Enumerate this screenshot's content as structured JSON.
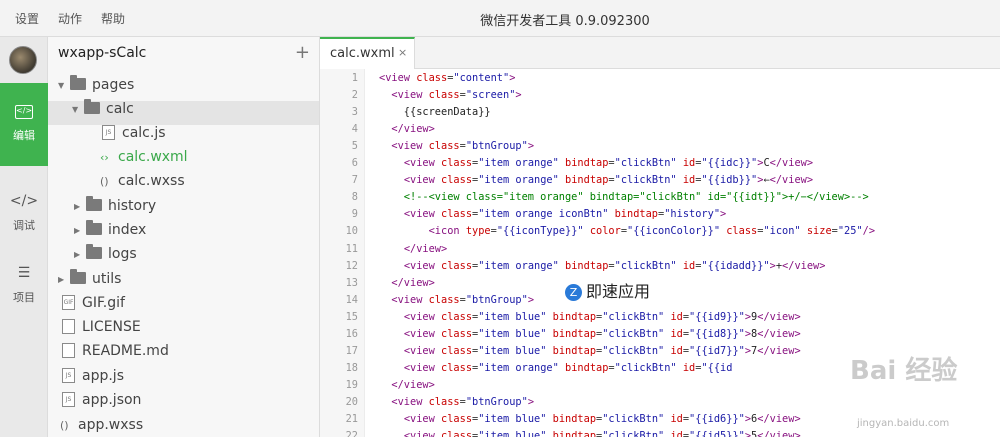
{
  "menu": {
    "items": [
      "设置",
      "动作",
      "帮助"
    ],
    "title": "微信开发者工具 0.9.092300"
  },
  "activity": {
    "edit_label": "编辑",
    "debug_label": "调试",
    "project_label": "项目"
  },
  "tree": {
    "project_name": "wxapp-sCalc",
    "add_label": "+",
    "nodes": [
      "pages",
      "calc",
      "calc.js",
      "calc.wxml",
      "calc.wxss",
      "history",
      "index",
      "logs",
      "utils",
      "GIF.gif",
      "LICENSE",
      "README.md",
      "app.js",
      "app.json",
      "app.wxss"
    ]
  },
  "tab": {
    "label": "calc.wxml",
    "close": "×"
  },
  "code": {
    "line_numbers": [
      "1",
      "2",
      "3",
      "4",
      "5",
      "6",
      "7",
      "8",
      "9",
      "10",
      "11",
      "12",
      "13",
      "14",
      "15",
      "16",
      "17",
      "18",
      "19",
      "20",
      "21",
      "22"
    ],
    "lines": [
      "<view class=\"content\">",
      "  <view class=\"screen\">",
      "    {{screenData}}",
      "  </view>",
      "  <view class=\"btnGroup\">",
      "    <view class=\"item orange\" bindtap=\"clickBtn\" id=\"{{idc}}\">C</view>",
      "    <view class=\"item orange\" bindtap=\"clickBtn\" id=\"{{idb}}\">←</view>",
      "    <!--<view class=\"item orange\" bindtap=\"clickBtn\" id=\"{{idt}}\">+/−</view>-->",
      "    <view class=\"item orange iconBtn\" bindtap=\"history\">",
      "        <icon type=\"{{iconType}}\" color=\"{{iconColor}}\" class=\"icon\" size=\"25\"/>",
      "    </view>",
      "    <view class=\"item orange\" bindtap=\"clickBtn\" id=\"{{idadd}}\">+</view>",
      "  </view>",
      "  <view class=\"btnGroup\">",
      "    <view class=\"item blue\" bindtap=\"clickBtn\" id=\"{{id9}}\">9</view>",
      "    <view class=\"item blue\" bindtap=\"clickBtn\" id=\"{{id8}}\">8</view>",
      "    <view class=\"item blue\" bindtap=\"clickBtn\" id=\"{{id7}}\">7</view>",
      "    <view class=\"item orange\" bindtap=\"clickBtn\" id=\"{{id",
      "  </view>",
      "  <view class=\"btnGroup\">",
      "    <view class=\"item blue\" bindtap=\"clickBtn\" id=\"{{id6}}\">6</view>",
      "    <view class=\"item blue\" bindtap=\"clickBtn\" id=\"{{id5}}\">5</view>"
    ]
  },
  "watermark": {
    "badge": "Z",
    "brand": "即速应用",
    "site_logo": "Bai 经验",
    "site_url": "jingyan.baidu.com"
  }
}
